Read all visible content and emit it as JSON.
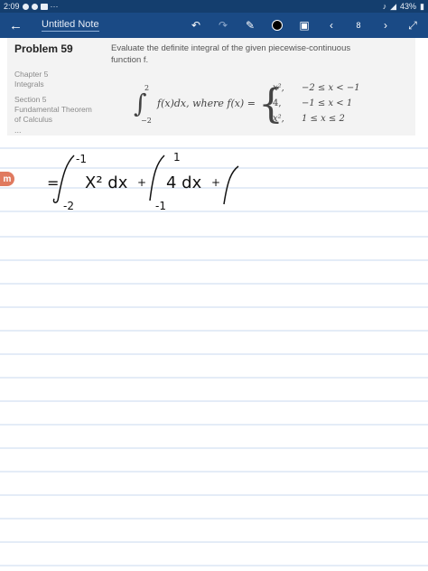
{
  "status_bar": {
    "time": "2:09",
    "dots": "···",
    "battery": "43%"
  },
  "app_bar": {
    "back_icon": "arrow-left-icon",
    "title": "Untitled Note",
    "page_number": "8"
  },
  "problem": {
    "title": "Problem 59",
    "chapter": "Chapter 5",
    "chapter_name": "Integrals",
    "section": "Section 5",
    "section_name_line1": "Fundamental Theorem",
    "section_name_line2": "of Calculus",
    "more": "...",
    "statement_line1": "Evaluate the definite integral of the given piecewise-continuous",
    "statement_line2": "function f.",
    "formula": {
      "upper": "2",
      "lower": "−2",
      "integrand": "f(x)dx, where f(x) =",
      "cases": [
        {
          "expr": "x², ",
          "cond": "−2 ≤ x < −1"
        },
        {
          "expr": "4,",
          "cond": "−1 ≤ x < 1"
        },
        {
          "expr": "x², ",
          "cond": "1 ≤ x ≤ 2"
        }
      ]
    }
  },
  "handwriting": {
    "eq": "=",
    "t1_upper": "-1",
    "t1_lower": "-2",
    "t1_body": "X² dx",
    "plus1": "+",
    "t2_upper": "1",
    "t2_lower": "-1",
    "t2_body": "4 dx",
    "plus2": "+"
  },
  "colors": {
    "appbar": "#1a4a85",
    "statusbar": "#143e6e",
    "rule_line": "#c9d9ef",
    "ink": "#111111",
    "card": "#f3f3f3",
    "mathpad": "#e07a5f"
  }
}
